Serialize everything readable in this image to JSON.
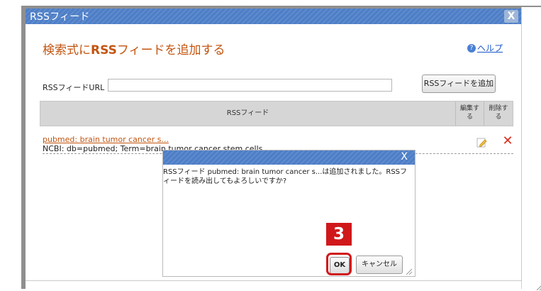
{
  "dialog": {
    "title": "RSSフィード",
    "close_label": "X",
    "heading_prefix": "検索式に",
    "heading_bold": "RSS",
    "heading_suffix": "フィードを追加する",
    "help_label": "ヘルプ",
    "help_icon_char": "?",
    "url_label": "RSSフィードURL",
    "url_value": "",
    "add_button_label": "RSSフィードを追加"
  },
  "table": {
    "columns": {
      "feed": "RSSフィード",
      "edit_line1": "編集す",
      "edit_line2": "る",
      "delete_line1": "削除す",
      "delete_line2": "る"
    },
    "rows": [
      {
        "title": "pubmed: brain tumor cancer s...",
        "description": "NCBI: db=pubmed; Term=brain tumor cancer stem cells"
      }
    ]
  },
  "alert": {
    "close_label": "X",
    "message": "RSSフィード pubmed: brain tumor cancer s...は追加されました。RSSフィードを読み出してもよろしいですか?",
    "ok_label": "OK",
    "cancel_label": "キャンセル"
  },
  "annotation": {
    "step_number": "3",
    "highlight_color": "#d0181b"
  },
  "colors": {
    "titlebar": "#4d7ec7",
    "heading": "#c25510",
    "link": "#1a56c8",
    "delete": "#dd2c1c"
  },
  "icons": {
    "help": "help-circle-icon",
    "edit": "pencil-icon",
    "delete": "x-delete-icon",
    "resize": "resize-grip-icon"
  }
}
